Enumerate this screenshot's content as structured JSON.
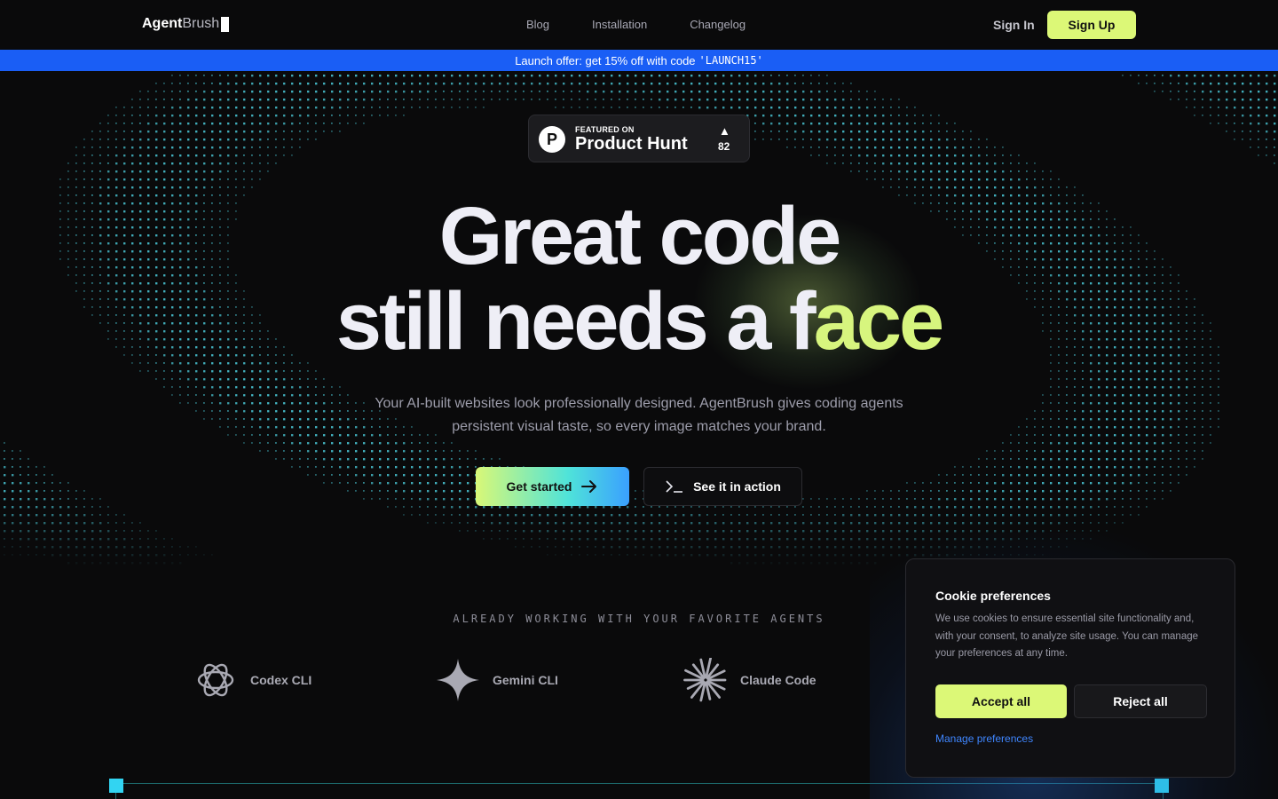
{
  "nav": {
    "logo_bold": "Agent",
    "logo_light": "Brush",
    "links": [
      "Blog",
      "Installation",
      "Changelog"
    ],
    "signin": "Sign In",
    "signup": "Sign Up"
  },
  "banner": {
    "text": "Launch offer: get 15% off with code",
    "code": "'LAUNCH15'"
  },
  "product_hunt": {
    "small": "FEATURED ON",
    "big": "Product Hunt",
    "logo_letter": "P",
    "upvote_icon": "triangle-up-icon",
    "count": "82"
  },
  "hero": {
    "line1": "Great code",
    "line2_plain": "still needs a f",
    "line2_accent": "ace",
    "subtitle_1": "Your AI-built websites look professionally designed. AgentBrush gives coding agents",
    "subtitle_2": "persistent visual taste, so every image matches your brand.",
    "cta_primary": "Get started",
    "cta_secondary": "See it in action",
    "accent_color": "#d7f57e"
  },
  "agents": {
    "title": "ALREADY WORKING WITH YOUR FAVORITE AGENTS",
    "items": [
      {
        "name": "Codex CLI",
        "icon": "openai-icon"
      },
      {
        "name": "Gemini CLI",
        "icon": "gemini-star-icon"
      },
      {
        "name": "Claude Code",
        "icon": "claude-burst-icon"
      }
    ]
  },
  "cookie": {
    "title": "Cookie preferences",
    "body": "We use cookies to ensure essential site functionality and, with your consent, to analyze site usage. You can manage your preferences at any time.",
    "accept": "Accept all",
    "reject": "Reject all",
    "manage": "Manage preferences"
  },
  "colors": {
    "brand_lime": "#dcf877",
    "banner_blue": "#1a5ef5",
    "dot_cyan": "#4fd8e8",
    "link_blue": "#3f86ff"
  }
}
